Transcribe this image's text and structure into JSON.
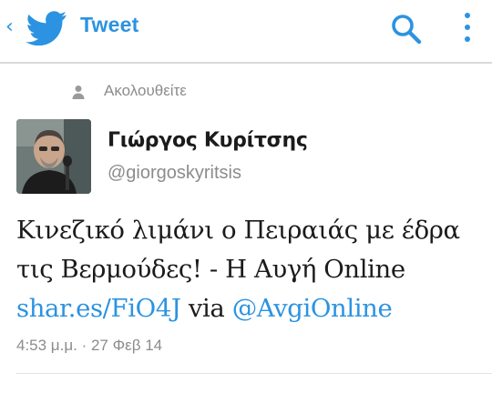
{
  "header": {
    "title": "Tweet",
    "back_icon": "chevron-left-icon",
    "logo_icon": "twitter-bird-icon",
    "search_icon": "search-icon",
    "more_icon": "more-vertical-icon",
    "accent": "#2b93e1"
  },
  "context": {
    "icon": "person-icon",
    "label": "Ακολουθείτε"
  },
  "tweet": {
    "author_name": "Γιώργος Κυρίτσης",
    "author_handle": "@giorgoskyritsis",
    "text_line1": "Κινεζικό λιμάνι ο Πειραιάς με έδρα",
    "text_line2": "τις Βερμούδες! - Η Αυγή Online",
    "link_url": "shar.es/FiO4J",
    "via_text": "via",
    "mention": "@AvgiOnline",
    "timestamp": "4:53 μ.μ. · 27 Φεβ 14"
  }
}
